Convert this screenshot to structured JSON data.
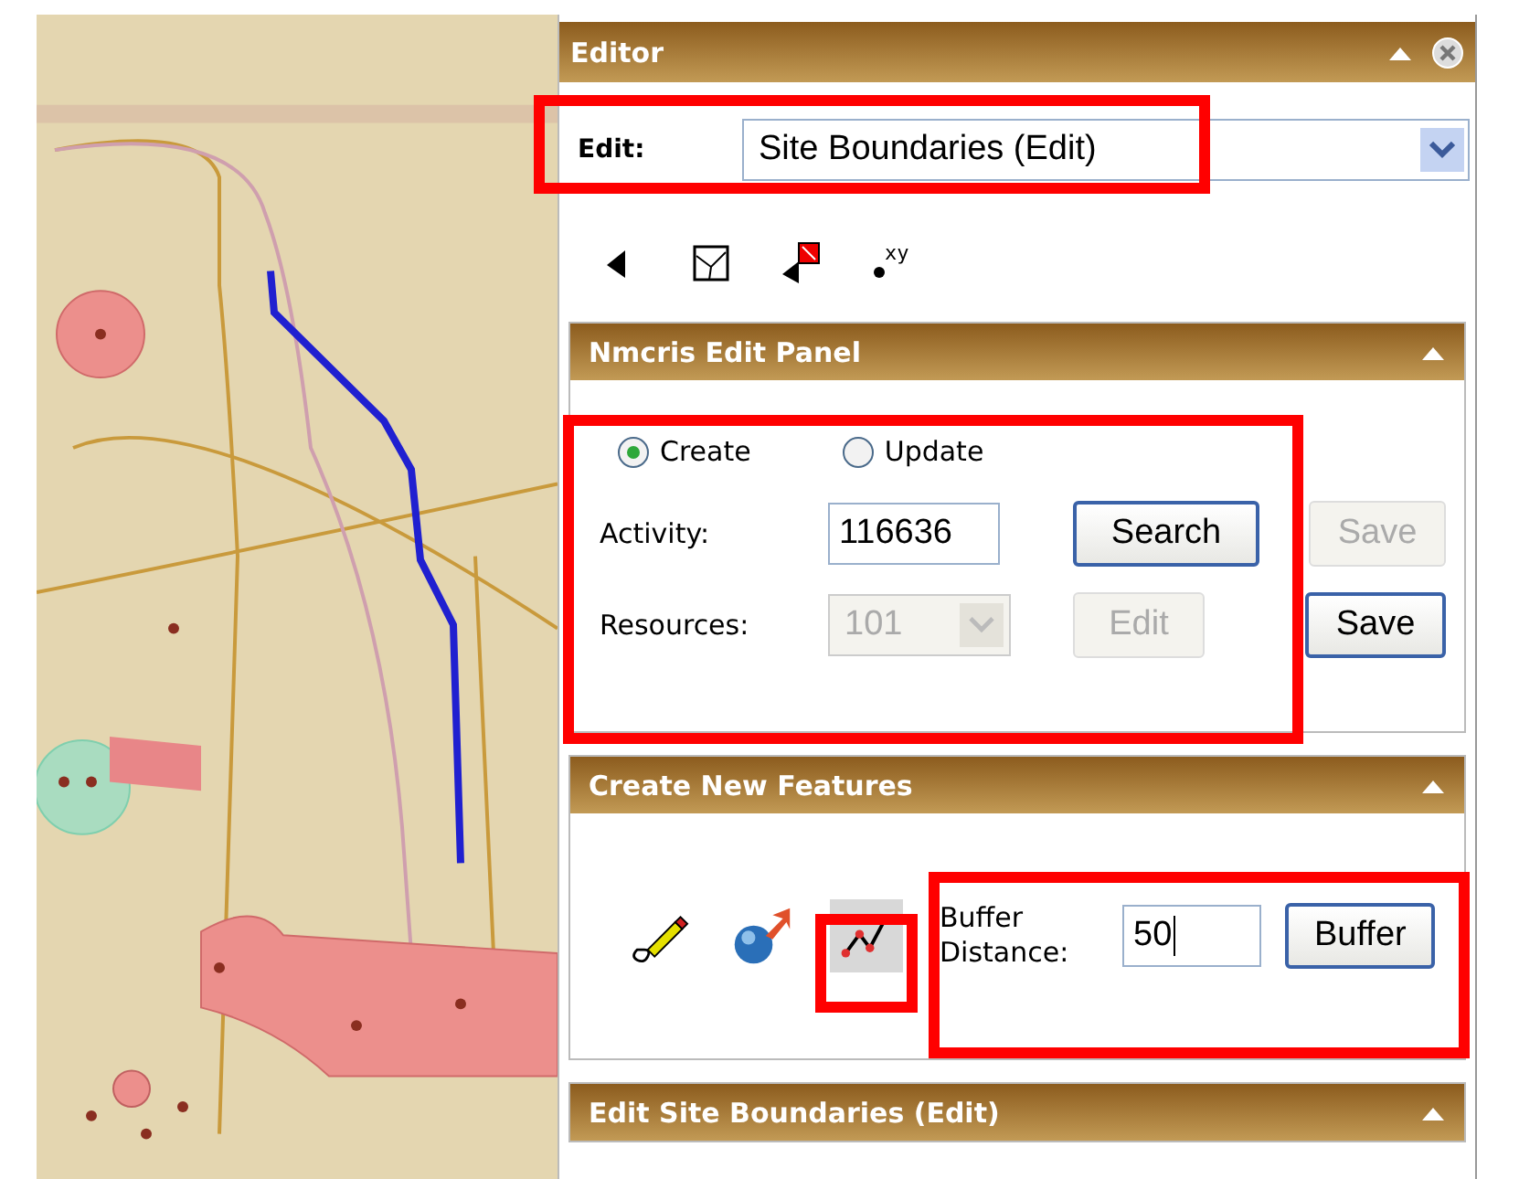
{
  "editor": {
    "title": "Editor",
    "edit_label": "Edit:",
    "layer_select": {
      "value": "Site Boundaries (Edit)"
    },
    "tools": [
      {
        "kind": "select"
      },
      {
        "kind": "reshape"
      },
      {
        "kind": "attributes"
      },
      {
        "kind": "xy",
        "label": "xy"
      }
    ]
  },
  "nmcris_panel": {
    "title": "Nmcris Edit Panel",
    "radios": [
      {
        "label": "Create",
        "selected": true
      },
      {
        "label": "Update",
        "selected": false
      }
    ],
    "activity": {
      "label": "Activity:",
      "value": "116636",
      "search_button": "Search",
      "save_button": {
        "label": "Save",
        "disabled": true
      }
    },
    "resources": {
      "label": "Resources:",
      "select": {
        "value": "101",
        "disabled": true
      },
      "edit_button": {
        "label": "Edit",
        "disabled": true
      },
      "save_button": {
        "label": "Save",
        "disabled": false
      }
    }
  },
  "create_panel": {
    "title": "Create New Features",
    "tools": [
      {
        "kind": "freehand",
        "selected": false
      },
      {
        "kind": "point",
        "selected": false
      },
      {
        "kind": "polyline",
        "selected": true
      }
    ],
    "buffer_label": "Buffer Distance:",
    "buffer_value": "50",
    "buffer_button": "Buffer"
  },
  "edit_site_panel": {
    "title": "Edit Site Boundaries (Edit)"
  }
}
